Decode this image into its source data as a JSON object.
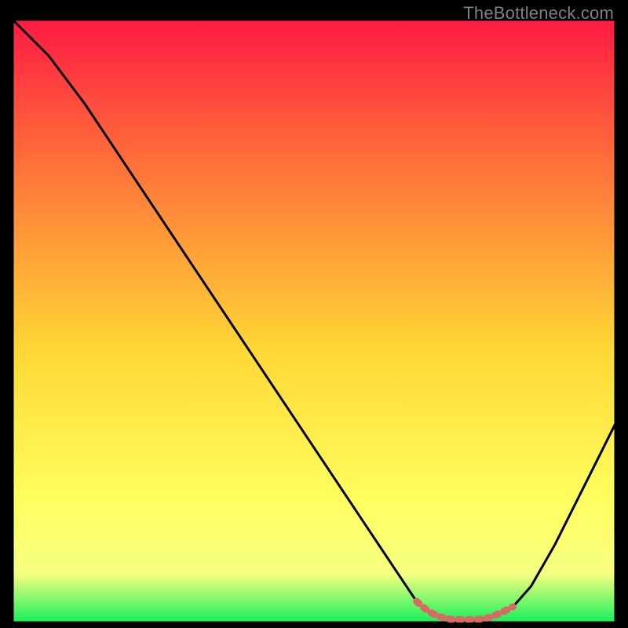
{
  "watermark": "TheBottleneck.com",
  "colors": {
    "top": "#ff1a44",
    "mid_upper": "#ff6a3a",
    "mid": "#ffd836",
    "mid_lower": "#ffff60",
    "lower": "#f6ff80",
    "bottom": "#13f05a",
    "plot_border": "#000000",
    "curve": "#000000",
    "highlight": "#d86a64"
  },
  "chart_data": {
    "type": "line",
    "title": "",
    "xlabel": "",
    "ylabel": "",
    "xlim": [
      0,
      100
    ],
    "ylim": [
      0,
      100
    ],
    "data_points": [
      {
        "x": 0,
        "y": 100
      },
      {
        "x": 6,
        "y": 94
      },
      {
        "x": 12,
        "y": 86
      },
      {
        "x": 20,
        "y": 74
      },
      {
        "x": 30,
        "y": 59
      },
      {
        "x": 40,
        "y": 44
      },
      {
        "x": 50,
        "y": 29
      },
      {
        "x": 58,
        "y": 17
      },
      {
        "x": 64,
        "y": 8
      },
      {
        "x": 67,
        "y": 3.5
      },
      {
        "x": 70,
        "y": 1.2
      },
      {
        "x": 73,
        "y": 0.5
      },
      {
        "x": 77,
        "y": 0.5
      },
      {
        "x": 80,
        "y": 1.0
      },
      {
        "x": 83,
        "y": 2.6
      },
      {
        "x": 86,
        "y": 6
      },
      {
        "x": 90,
        "y": 13
      },
      {
        "x": 95,
        "y": 23
      },
      {
        "x": 100,
        "y": 33
      }
    ],
    "highlight_range_x": [
      67,
      83
    ],
    "highlight_points": [
      {
        "x": 67,
        "y": 3.5
      },
      {
        "x": 69,
        "y": 1.8
      },
      {
        "x": 71,
        "y": 0.9
      },
      {
        "x": 73,
        "y": 0.5
      },
      {
        "x": 75,
        "y": 0.5
      },
      {
        "x": 77,
        "y": 0.5
      },
      {
        "x": 79,
        "y": 0.8
      },
      {
        "x": 81,
        "y": 1.6
      },
      {
        "x": 83,
        "y": 2.6
      }
    ]
  }
}
